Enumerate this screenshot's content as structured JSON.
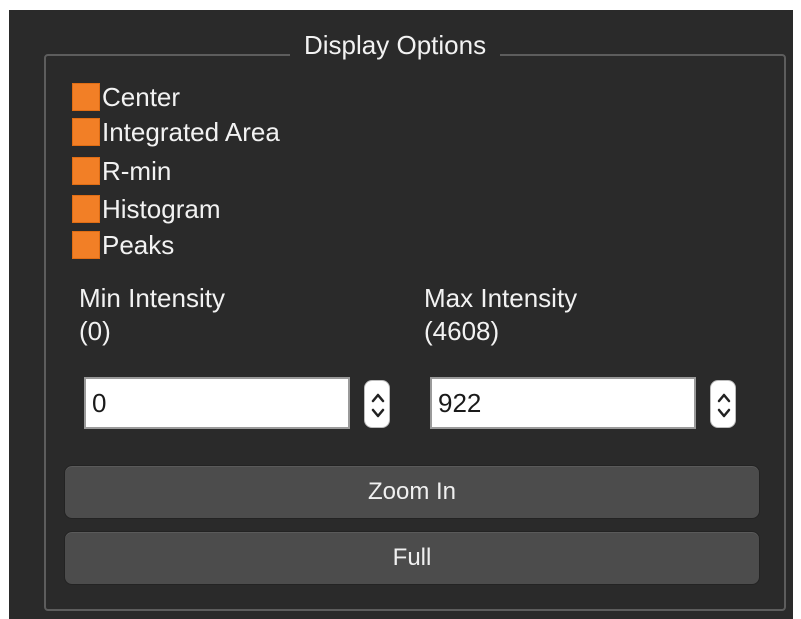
{
  "group": {
    "title": "Display Options"
  },
  "checkboxes": [
    {
      "label": "Center",
      "checked": true
    },
    {
      "label": "Integrated Area",
      "checked": true
    },
    {
      "label": "R-min",
      "checked": true
    },
    {
      "label": "Histogram",
      "checked": true
    },
    {
      "label": "Peaks",
      "checked": true
    }
  ],
  "min_intensity": {
    "label": "Min Intensity",
    "range": "(0)",
    "value": "0"
  },
  "max_intensity": {
    "label": "Max Intensity",
    "range": "(4608)",
    "value": "922"
  },
  "buttons": {
    "zoom_in": "Zoom In",
    "full": "Full"
  },
  "colors": {
    "panel_bg": "#2a2a2a",
    "checkbox_fill": "#f27f26",
    "button_bg": "#4c4c4c",
    "text": "#f2f2f2"
  },
  "icons": {
    "spin_arrows": "up-down-chevrons"
  }
}
